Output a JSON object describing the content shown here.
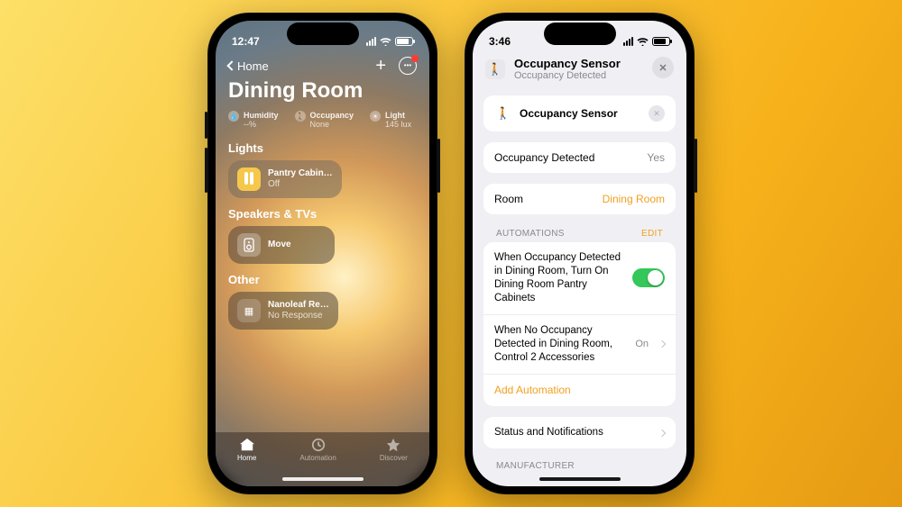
{
  "left": {
    "time": "12:47",
    "back_label": "Home",
    "title": "Dining Room",
    "metrics": [
      {
        "label": "Humidity",
        "value": "--%"
      },
      {
        "label": "Occupancy",
        "value": "None"
      },
      {
        "label": "Light",
        "value": "145 lux"
      }
    ],
    "sections": {
      "lights": {
        "heading": "Lights",
        "tile_name": "Pantry Cabin…",
        "tile_status": "Off"
      },
      "speakers": {
        "heading": "Speakers & TVs",
        "tile_name": "Move"
      },
      "other": {
        "heading": "Other",
        "tile_name": "Nanoleaf Re…",
        "tile_status": "No Response"
      }
    },
    "tabs": {
      "home": "Home",
      "automation": "Automation",
      "discover": "Discover"
    }
  },
  "right": {
    "time": "3:46",
    "header": {
      "title": "Occupancy Sensor",
      "subtitle": "Occupancy Detected"
    },
    "name_card": {
      "label": "Occupancy Sensor"
    },
    "detected": {
      "label": "Occupancy Detected",
      "value": "Yes"
    },
    "room": {
      "label": "Room",
      "value": "Dining Room"
    },
    "automations": {
      "heading": "AUTOMATIONS",
      "edit": "EDIT",
      "items": [
        {
          "text": "When Occupancy Detected in Dining Room, Turn On Dining Room Pantry Cabinets",
          "toggle": true
        },
        {
          "text": "When No Occupancy Detected in Dining Room, Control 2 Accessories",
          "value": "On"
        }
      ],
      "add": "Add Automation"
    },
    "status_row": "Status and Notifications",
    "manufacturer_heading": "MANUFACTURER"
  }
}
